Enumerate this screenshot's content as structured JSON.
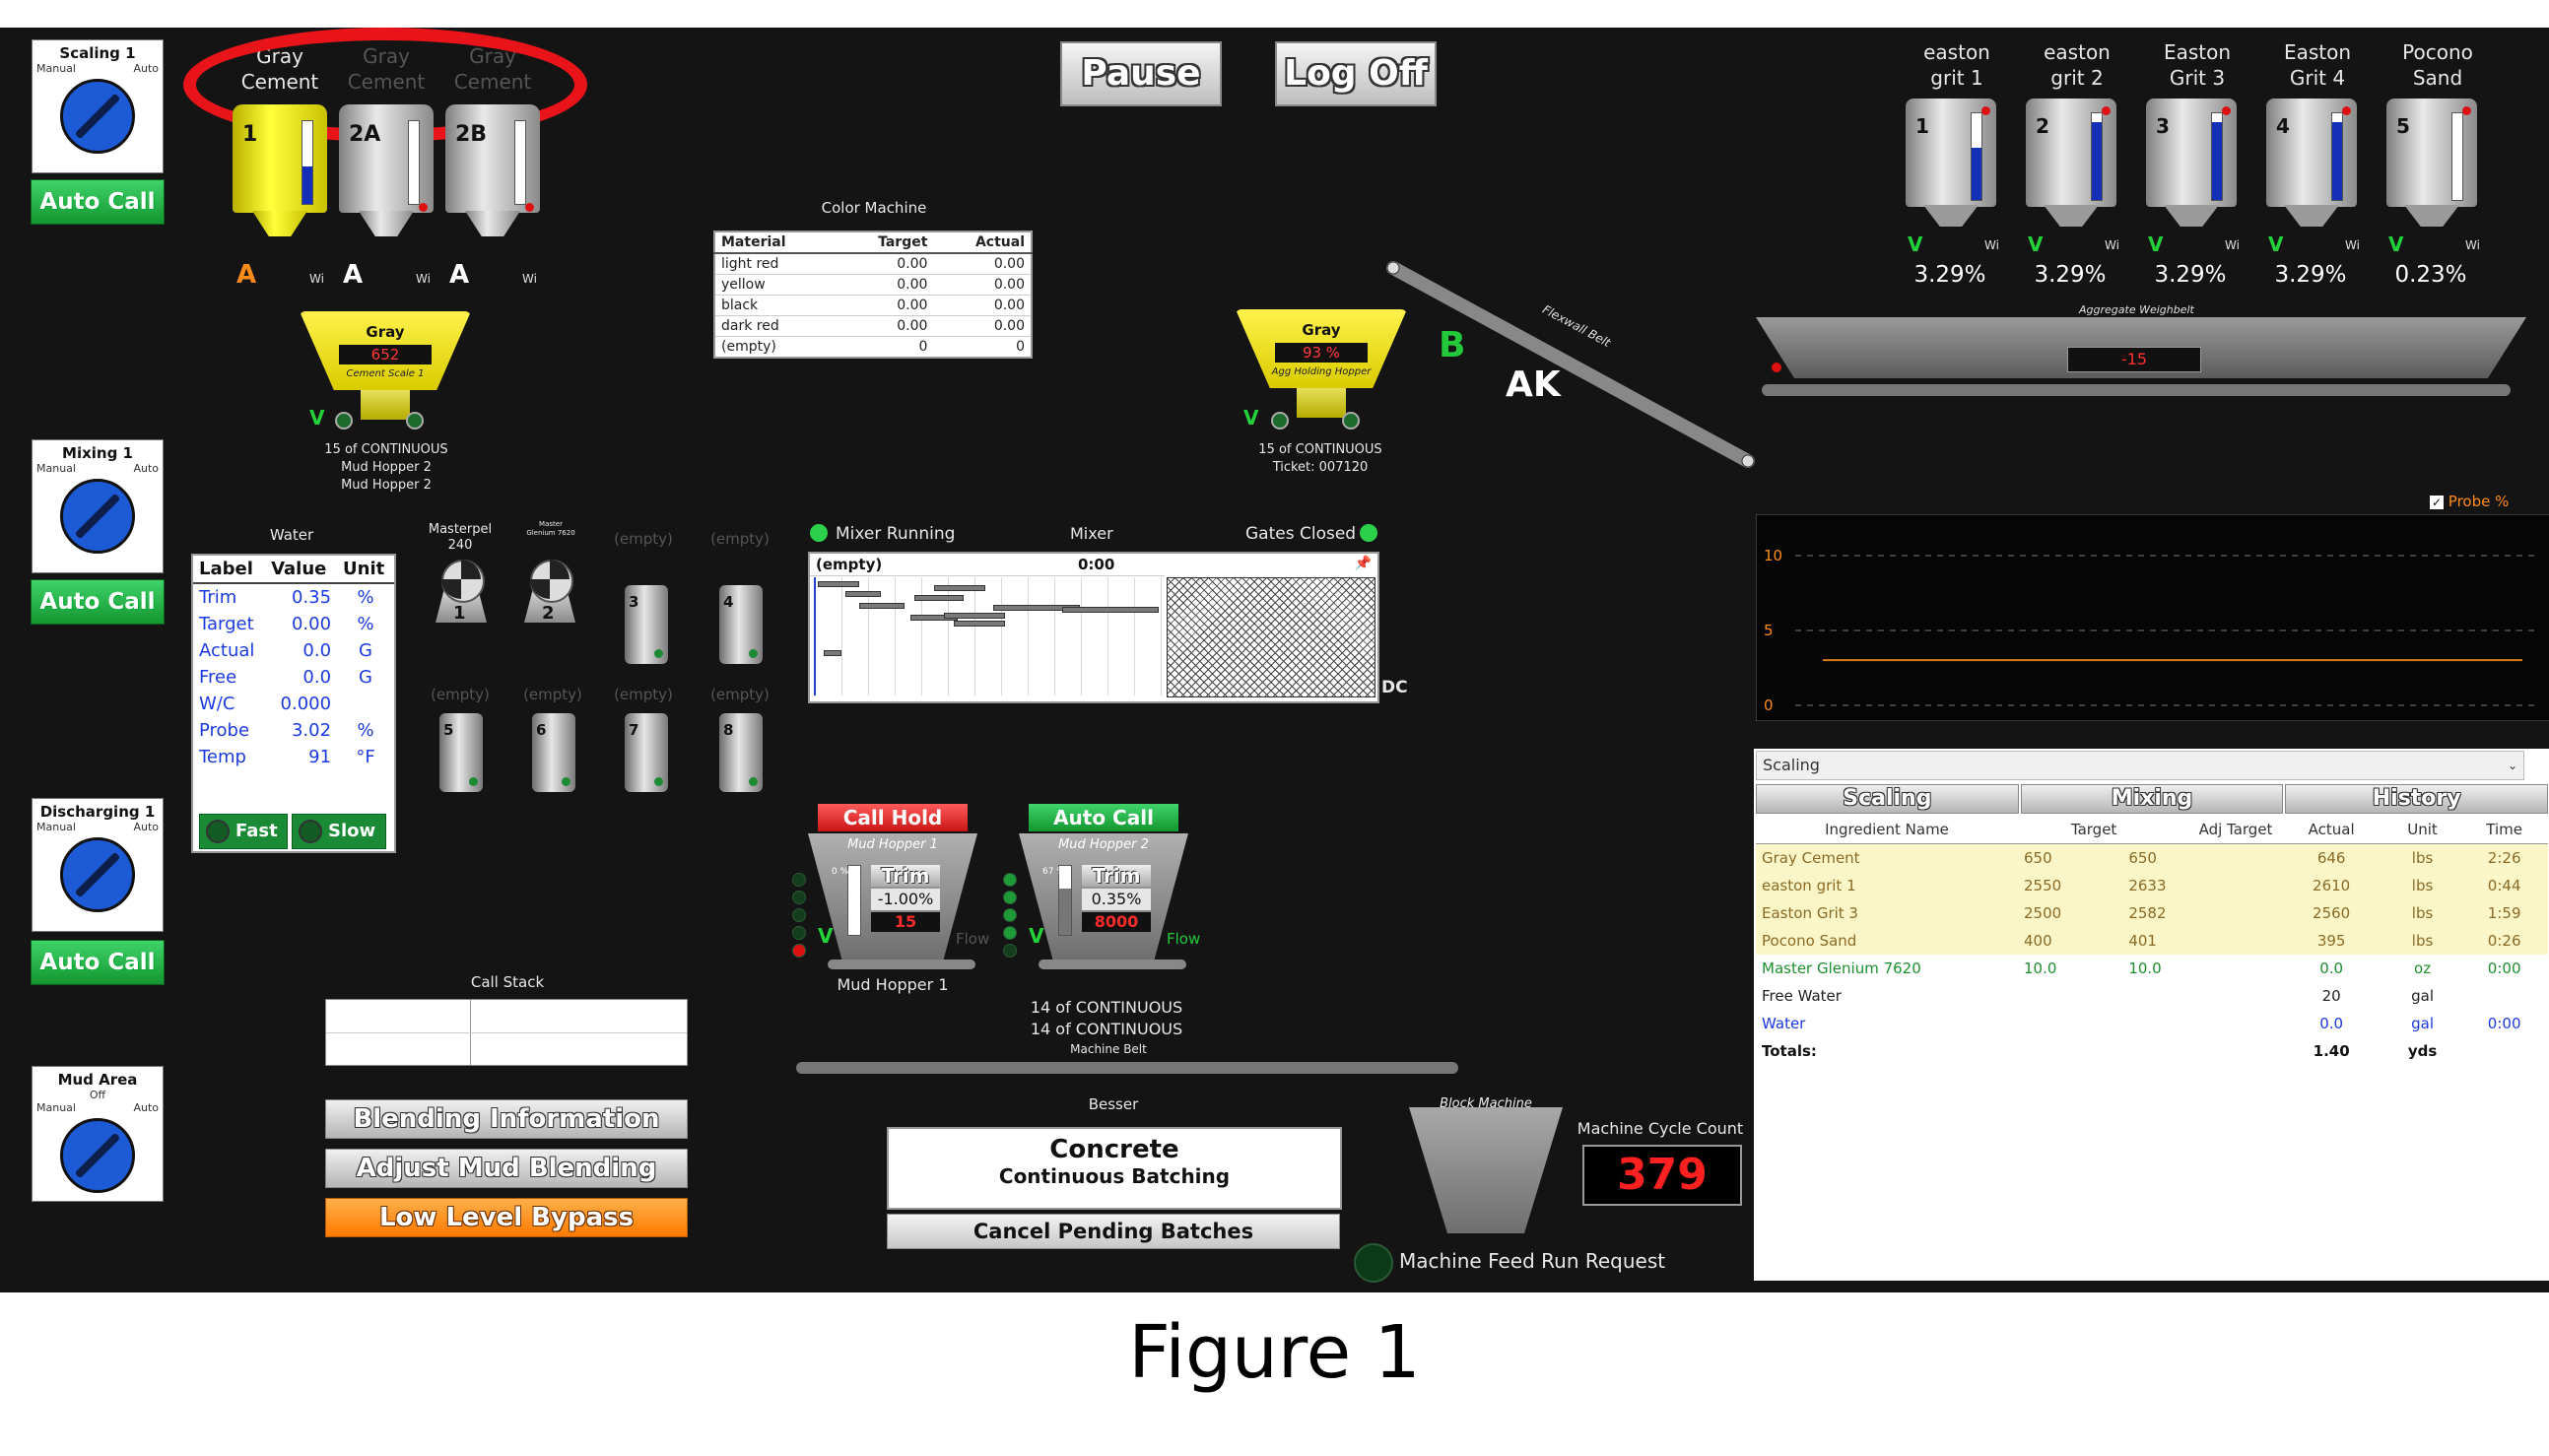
{
  "top": {
    "pause": "Pause",
    "logoff": "Log Off"
  },
  "switches": [
    {
      "title": "Scaling 1",
      "manual": "Manual",
      "auto": "Auto",
      "button": "Auto Call"
    },
    {
      "title": "Mixing 1",
      "manual": "Manual",
      "auto": "Auto",
      "button": "Auto Call"
    },
    {
      "title": "Discharging 1",
      "manual": "Manual",
      "auto": "Auto",
      "button": "Auto Call"
    },
    {
      "title": "Mud Area",
      "status": "Off",
      "manual": "Manual",
      "auto": "Auto"
    }
  ],
  "cement_silos": [
    {
      "label1": "Gray",
      "label2": "Cement",
      "num": "1",
      "letter": "A"
    },
    {
      "label1": "Gray",
      "label2": "Cement",
      "num": "2A",
      "letter": "A"
    },
    {
      "label1": "Gray",
      "label2": "Cement",
      "num": "2B",
      "letter": "A"
    }
  ],
  "wi": "Wi",
  "cement_scale": {
    "name": "Gray",
    "value": "652",
    "sub": "Cement Scale 1",
    "v": "V",
    "line1": "15 of CONTINUOUS",
    "line2": "Mud Hopper 2",
    "line3": "Mud Hopper 2"
  },
  "color_machine": {
    "title": "Color Machine",
    "headers": [
      "Material",
      "Target",
      "Actual"
    ],
    "rows": [
      [
        "light red",
        "0.00",
        "0.00"
      ],
      [
        "yellow",
        "0.00",
        "0.00"
      ],
      [
        "black",
        "0.00",
        "0.00"
      ],
      [
        "dark red",
        "0.00",
        "0.00"
      ],
      [
        "(empty)",
        "0",
        "0"
      ]
    ]
  },
  "agg_hopper": {
    "name": "Gray",
    "value": "93 %",
    "sub": "Agg Holding Hopper",
    "v": "V",
    "line1": "15 of CONTINUOUS",
    "line2": "Ticket: 007120",
    "b": "B",
    "ak": "AK"
  },
  "flexwall": "Flexwall Belt",
  "aggregates": [
    {
      "l1": "easton",
      "l2": "grit 1",
      "num": "1",
      "pct": "3.29%",
      "fill": 0.6
    },
    {
      "l1": "easton",
      "l2": "grit 2",
      "num": "2",
      "pct": "3.29%",
      "fill": 0.9
    },
    {
      "l1": "Easton",
      "l2": "Grit 3",
      "num": "3",
      "pct": "3.29%",
      "fill": 0.9
    },
    {
      "l1": "Easton",
      "l2": "Grit 4",
      "num": "4",
      "pct": "3.29%",
      "fill": 0.9
    },
    {
      "l1": "Pocono",
      "l2": "Sand",
      "num": "5",
      "pct": "0.23%",
      "fill": 0.0
    }
  ],
  "agg_weighbelt": {
    "title": "Aggregate Weighbelt",
    "value": "-15"
  },
  "water": {
    "title": "Water",
    "headers": [
      "Label",
      "Value",
      "Unit"
    ],
    "rows": [
      [
        "Trim",
        "0.35",
        "%"
      ],
      [
        "Target",
        "0.00",
        "%"
      ],
      [
        "Actual",
        "0.0",
        "G"
      ],
      [
        "Free",
        "0.0",
        "G"
      ],
      [
        "W/C",
        "0.000",
        ""
      ],
      [
        "Probe",
        "3.02",
        "%"
      ],
      [
        "Temp",
        "91",
        "°F"
      ]
    ],
    "fast": "Fast",
    "slow": "Slow"
  },
  "admix": {
    "top": [
      {
        "label": "Masterpel",
        "sub": "240",
        "num": "1"
      },
      {
        "label": "Master Glenium 7620",
        "num": "2"
      },
      {
        "label": "(empty)",
        "num": "3"
      },
      {
        "label": "(empty)",
        "num": "4"
      }
    ],
    "bottom": [
      {
        "label": "(empty)",
        "num": "5"
      },
      {
        "label": "(empty)",
        "num": "6"
      },
      {
        "label": "(empty)",
        "num": "7"
      },
      {
        "label": "(empty)",
        "num": "8"
      }
    ]
  },
  "mixer": {
    "running": "Mixer Running",
    "title": "Mixer",
    "gates": "Gates Closed",
    "batch": "(empty)",
    "time": "0:00",
    "dc": "DC"
  },
  "mud_hoppers": [
    {
      "button": "Call Hold",
      "name": "Mud Hopper 1",
      "pct": "0 %",
      "trim_label": "Trim",
      "trim": "-1.00%",
      "value": "15",
      "flow": "Flow",
      "v": "V"
    },
    {
      "button": "Auto Call",
      "name": "Mud Hopper 2",
      "pct": "67 %",
      "trim_label": "Trim",
      "trim": "0.35%",
      "value": "8000",
      "flow": "Flow",
      "v": "V"
    }
  ],
  "mud_hopper_caption": "Mud Hopper 1",
  "continuous1": "14 of CONTINUOUS",
  "continuous2": "14 of CONTINUOUS",
  "machine_belt": "Machine Belt",
  "call_stack": {
    "title": "Call Stack"
  },
  "buttons": {
    "blending": "Blending Information",
    "adjust": "Adjust Mud Blending",
    "bypass": "Low Level Bypass"
  },
  "besser": {
    "title": "Besser",
    "line1": "Concrete",
    "line2": "Continuous Batching",
    "cancel": "Cancel Pending Batches"
  },
  "block_machine": "Block Machine",
  "cycle": {
    "label": "Machine Cycle Count",
    "value": "379"
  },
  "feed_request": "Machine Feed Run Request",
  "probe_chart": {
    "checkbox": "Probe %",
    "ticks": [
      "10",
      "5",
      "0"
    ]
  },
  "chart_data": {
    "type": "line",
    "ylim": [
      0,
      10
    ],
    "series": [
      {
        "values": [
          3.02,
          3.02
        ]
      }
    ],
    "colors": [
      "#d87a1a"
    ]
  },
  "scaling_panel": {
    "dropdown": "Scaling",
    "tabs": [
      "Scaling",
      "Mixing",
      "History"
    ],
    "headers": [
      "Ingredient Name",
      "Target",
      "Adj Target",
      "Actual",
      "Unit",
      "Time"
    ],
    "rows": [
      [
        "Gray Cement",
        "650",
        "650",
        "646",
        "lbs",
        "2:26"
      ],
      [
        "easton grit 1",
        "2550",
        "2633",
        "2610",
        "lbs",
        "0:44"
      ],
      [
        "Easton Grit 3",
        "2500",
        "2582",
        "2560",
        "lbs",
        "1:59"
      ],
      [
        "Pocono Sand",
        "400",
        "401",
        "395",
        "lbs",
        "0:26"
      ],
      [
        "Master Glenium 7620",
        "10.0",
        "10.0",
        "0.0",
        "oz",
        "0:00"
      ],
      [
        "Free Water",
        "",
        "",
        "20",
        "gal",
        ""
      ],
      [
        "Water",
        "",
        "",
        "0.0",
        "gal",
        "0:00"
      ],
      [
        "Totals:",
        "",
        "",
        "1.40",
        "yds",
        ""
      ]
    ]
  },
  "caption": "Figure 1"
}
